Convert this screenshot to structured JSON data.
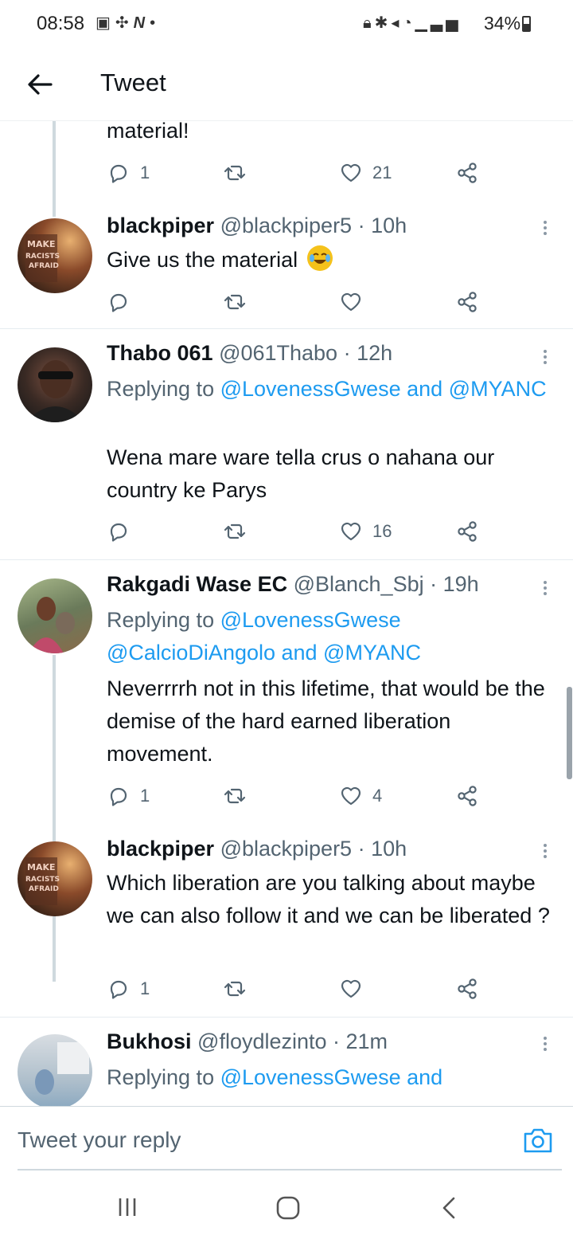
{
  "status_bar": {
    "time": "08:58",
    "left_icons": [
      "image-icon",
      "fan-icon",
      "n-icon",
      "dot-icon"
    ],
    "right_icons": [
      "lock-icon",
      "bluetooth-icon",
      "mute-icon",
      "wifi-icon",
      "signal-icon"
    ],
    "battery": "34%"
  },
  "header": {
    "title": "Tweet"
  },
  "tweets": [
    {
      "text": "material!",
      "replies": "1",
      "likes": "21"
    },
    {
      "name": "blackpiper",
      "handle": "@blackpiper5 · 10h",
      "text": "Give us the material",
      "emoji": "face-with-tears-of-joy"
    },
    {
      "name": "Thabo 061",
      "handle": "@061Thabo · 12h",
      "reply_prefix": "Replying to",
      "reply_links": "@LovenessGwese and @MYANC",
      "text": "Wena mare ware tella crus o nahana our country  ke Parys",
      "likes": "16"
    },
    {
      "name": "Rakgadi Wase EC",
      "handle": "@Blanch_Sbj · 19h",
      "reply_prefix": "Replying to",
      "reply_links": "@LovenessGwese @CalcioDiAngolo and @MYANC",
      "text": "Neverrrrh not in this lifetime, that would be the demise of the hard earned liberation movement.",
      "replies": "1",
      "likes": "4"
    },
    {
      "name": "blackpiper",
      "handle": "@blackpiper5 · 10h",
      "text": "Which liberation are you talking about maybe we can also follow it and we can be liberated ?",
      "replies": "1"
    },
    {
      "name": "Bukhosi",
      "handle": "@floydlezinto · 21m",
      "reply_prefix": "Replying to",
      "reply_links": "@LovenessGwese and"
    }
  ],
  "reply_bar": {
    "placeholder": "Tweet your reply"
  },
  "colors": {
    "link": "#1d9bf0",
    "secondary": "#536471",
    "text": "#0f1419"
  }
}
